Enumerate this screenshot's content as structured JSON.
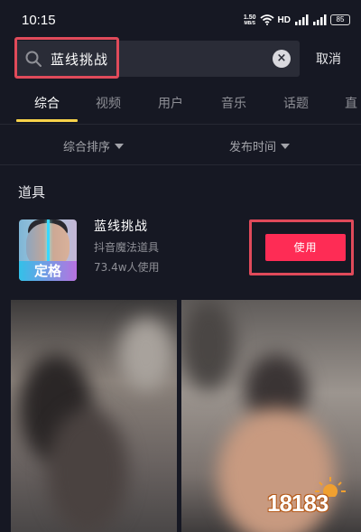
{
  "status_bar": {
    "time": "10:15",
    "net_speed_value": "1.50",
    "net_speed_unit": "MB/S",
    "hd_label": "HD",
    "battery": "85"
  },
  "search": {
    "query": "蓝线挑战",
    "cancel_label": "取消"
  },
  "tabs": [
    {
      "label": "综合",
      "active": true
    },
    {
      "label": "视频"
    },
    {
      "label": "用户"
    },
    {
      "label": "音乐"
    },
    {
      "label": "话题"
    },
    {
      "label": "直"
    }
  ],
  "filters": {
    "sort_label": "综合排序",
    "time_label": "发布时间"
  },
  "section": {
    "title": "道具"
  },
  "effect": {
    "thumb_label": "定格",
    "name": "蓝线挑战",
    "source": "抖音魔法道具",
    "users": "73.4w人使用",
    "use_label": "使用"
  },
  "watermark": {
    "text": "18183"
  },
  "colors": {
    "background": "#161823",
    "accent_tab": "#f7d24a",
    "use_button": "#fe2c55",
    "highlight_box": "#e04a5a"
  }
}
